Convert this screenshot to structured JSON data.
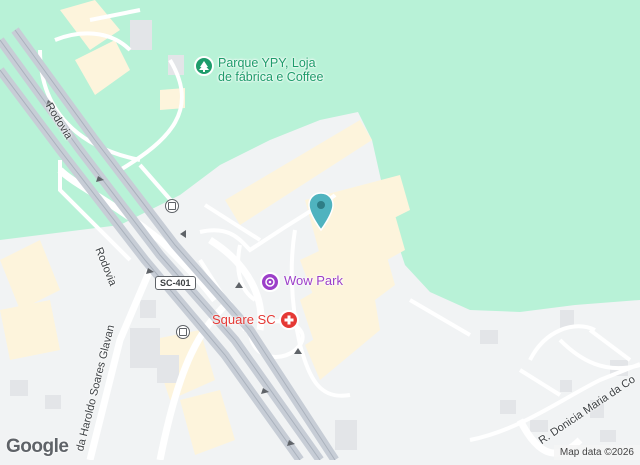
{
  "map": {
    "colors": {
      "park": "#b8f2d7",
      "background": "#f1f3f4",
      "built_area": "#fdf4dc",
      "highway": "#c7cdd6",
      "road": "#ffffff",
      "medical": "#e53935",
      "attraction": "#9c3fc9",
      "park_poi": "#1e9c6b",
      "pin": "#4fb3bf"
    },
    "pois": [
      {
        "name": "Parque YPY, Loja de fábrica e Coffee",
        "line1": "Parque YPY, Loja",
        "line2": "de fábrica e Coffee",
        "icon": "tree-icon"
      },
      {
        "name": "Wow Park",
        "icon": "attraction-icon"
      },
      {
        "name": "Square SC",
        "icon": "hospital-icon"
      }
    ],
    "roads": [
      {
        "label": "Rodovia"
      },
      {
        "label": "Rodovia"
      },
      {
        "label": "da Haroldo Soares Glavan"
      },
      {
        "label": "R. Donicia Maria da Co"
      }
    ],
    "shield": "SC-401",
    "logo": "Google",
    "attribution": "Map data ©2026"
  }
}
